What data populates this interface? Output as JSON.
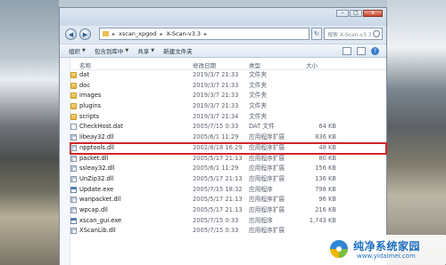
{
  "window": {
    "breadcrumb": [
      "xscan_xpgod",
      "X-Scan-v3.3"
    ],
    "search_placeholder": "搜索 X-Scan-v3.3",
    "controls": {
      "minimize": "–",
      "maximize": "□",
      "close": "x"
    }
  },
  "toolbar": {
    "organize": "组织",
    "include_in_library": "包含到库中",
    "share": "共享",
    "new_folder": "新建文件夹"
  },
  "columns": {
    "name": "名称",
    "date": "修改日期",
    "type": "类型",
    "size": "大小"
  },
  "files": [
    {
      "name": "dat",
      "date": "2019/3/7 21:33",
      "type": "文件夹",
      "size": "",
      "icon": "folder-icon"
    },
    {
      "name": "doc",
      "date": "2019/3/7 21:33",
      "type": "文件夹",
      "size": "",
      "icon": "folder-icon"
    },
    {
      "name": "images",
      "date": "2019/3/7 21:33",
      "type": "文件夹",
      "size": "",
      "icon": "folder-icon"
    },
    {
      "name": "plugins",
      "date": "2019/3/7 21:33",
      "type": "文件夹",
      "size": "",
      "icon": "folder-icon"
    },
    {
      "name": "scripts",
      "date": "2019/3/7 21:34",
      "type": "文件夹",
      "size": "",
      "icon": "folder-icon"
    },
    {
      "name": "CheckHost.dat",
      "date": "2005/7/15 0:33",
      "type": "DAT 文件",
      "size": "64 KB",
      "icon": "file-icon"
    },
    {
      "name": "libeay32.dll",
      "date": "2005/6/1 11:29",
      "type": "应用程序扩展",
      "size": "836 KB",
      "icon": "dll-icon"
    },
    {
      "name": "npptools.dll",
      "date": "2002/8/18 16:29",
      "type": "应用程序扩展",
      "size": "48 KB",
      "icon": "dll-icon",
      "highlighted": true
    },
    {
      "name": "packet.dll",
      "date": "2005/5/17 21:13",
      "type": "应用程序扩展",
      "size": "80 KB",
      "icon": "dll-icon"
    },
    {
      "name": "ssleay32.dll",
      "date": "2005/6/1 11:29",
      "type": "应用程序扩展",
      "size": "156 KB",
      "icon": "dll-icon"
    },
    {
      "name": "UnZip32.dll",
      "date": "2005/5/17 21:13",
      "type": "应用程序扩展",
      "size": "136 KB",
      "icon": "dll-icon"
    },
    {
      "name": "Update.exe",
      "date": "2005/7/15 18:32",
      "type": "应用程序",
      "size": "798 KB",
      "icon": "exe-icon"
    },
    {
      "name": "wanpacket.dll",
      "date": "2005/5/17 21:13",
      "type": "应用程序扩展",
      "size": "96 KB",
      "icon": "dll-icon"
    },
    {
      "name": "wpcap.dll",
      "date": "2005/5/17 21:13",
      "type": "应用程序扩展",
      "size": "216 KB",
      "icon": "dll-icon"
    },
    {
      "name": "xscan_gui.exe",
      "date": "2005/7/15 0:33",
      "type": "应用程序",
      "size": "1,743 KB",
      "icon": "exe-icon"
    },
    {
      "name": "XScanLib.dll",
      "date": "2005/7/15 0:33",
      "type": "应用程序扩展",
      "size": "",
      "icon": "dll-icon"
    }
  ],
  "watermark": {
    "title": "纯净系统家园",
    "url": "www.yidaimei.com"
  },
  "colors": {
    "highlight": "#d3232a",
    "accent": "#1e6fbf"
  }
}
